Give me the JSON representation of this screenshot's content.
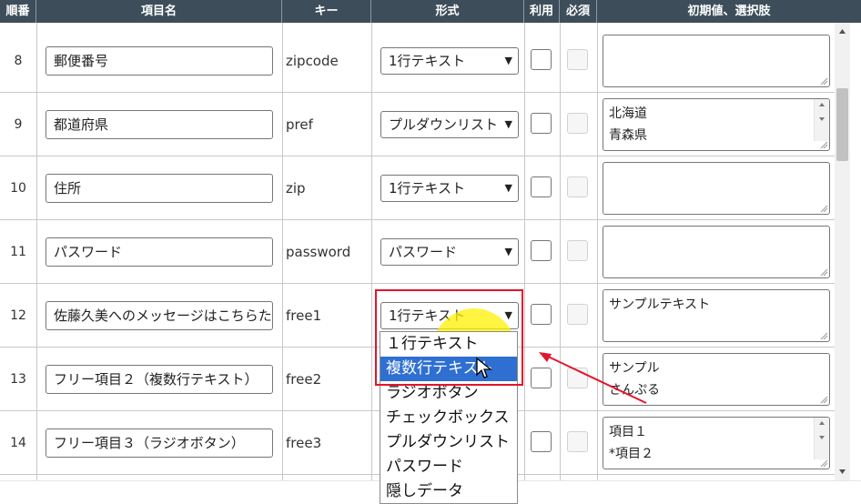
{
  "header": {
    "columns": [
      "順番",
      "項目名",
      "キー",
      "形式",
      "利用",
      "必須",
      "初期値、選択肢"
    ]
  },
  "rows": [
    {
      "num": "8",
      "name": "郵便番号",
      "key": "zipcode",
      "format": "1行テキスト",
      "default": ""
    },
    {
      "num": "9",
      "name": "都道府県",
      "key": "pref",
      "format": "プルダウンリスト",
      "default": "北海道\n青森県"
    },
    {
      "num": "10",
      "name": "住所",
      "key": "zip",
      "format": "1行テキスト",
      "default": ""
    },
    {
      "num": "11",
      "name": "パスワード",
      "key": "password",
      "format": "パスワード",
      "default": ""
    },
    {
      "num": "12",
      "name": "佐藤久美へのメッセージはこちらた",
      "key": "free1",
      "format": "1行テキスト",
      "default": "サンプルテキスト"
    },
    {
      "num": "13",
      "name": "フリー項目２（複数行テキスト）",
      "key": "free2",
      "format": "",
      "default": "サンプル\nさんぷる"
    },
    {
      "num": "14",
      "name": "フリー項目３（ラジオボタン）",
      "key": "free3",
      "format": "",
      "default": "項目１\n*項目２"
    }
  ],
  "dropdown": {
    "options": [
      "１行テキスト",
      "複数行テキスト",
      "ラジオボタン",
      "チェックボックス",
      "プルダウンリスト",
      "パスワード",
      "隠しデータ"
    ],
    "selected_index": 1
  },
  "colors": {
    "header_bg": "#3d4e5a",
    "selected_option": "#2f6fd2",
    "annotation_red": "#e3142b",
    "highlight_yellow": "#fff000"
  }
}
